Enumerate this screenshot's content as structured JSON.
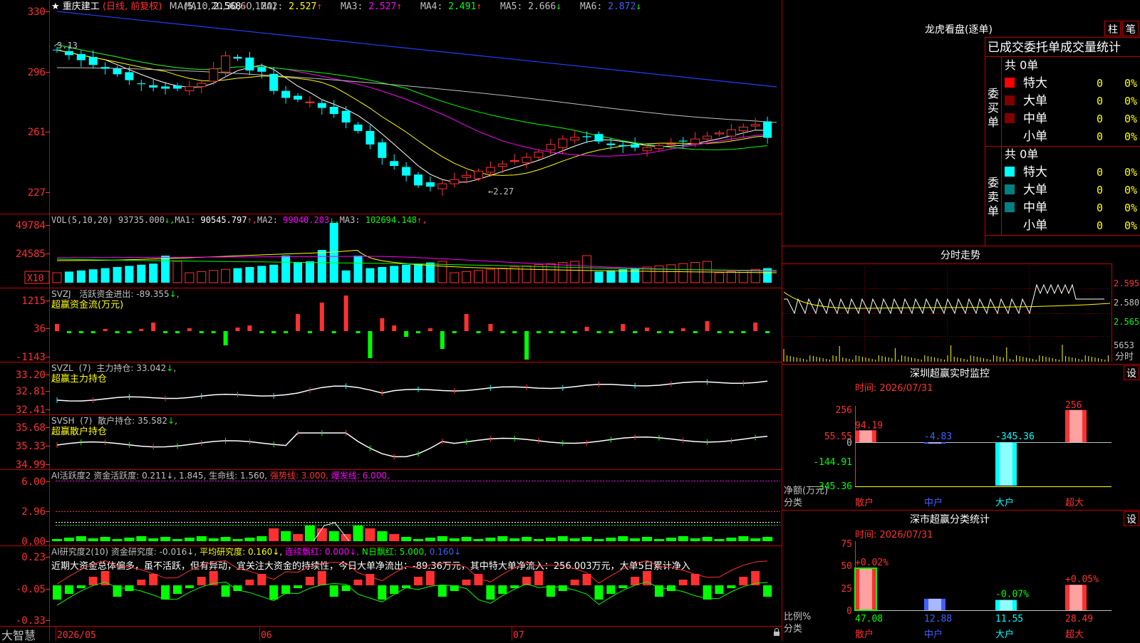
{
  "stock": {
    "name": "重庆建工",
    "star": "★",
    "period": "(日线, 前复权)"
  },
  "colors": {
    "bg": "#000000",
    "frame": "#c00000",
    "up": "#ff3030",
    "down": "#00ffff",
    "ma1": "#ffffff",
    "ma2": "#ffff00",
    "ma3": "#ff00ff",
    "ma4": "#00ff00",
    "ma5": "#c0c0c0",
    "ma6": "#0000ff",
    "green": "#00ff00",
    "yellow": "#ffff00",
    "magenta": "#ff00ff",
    "red": "#ff3030"
  },
  "price_panel": {
    "ma_label": "MA(5,10,20,30,60,120)",
    "ma": [
      {
        "name": "MA1:",
        "value": "2.568",
        "arrow": "↑",
        "arrow_color": "#ff3030",
        "color": "#ffffff"
      },
      {
        "name": "MA2:",
        "value": "2.527",
        "arrow": "↑",
        "arrow_color": "#ff3030",
        "color": "#ffff00"
      },
      {
        "name": "MA3:",
        "value": "2.527",
        "arrow": "↑",
        "arrow_color": "#ff3030",
        "color": "#ff00ff"
      },
      {
        "name": "MA4:",
        "value": "2.491",
        "arrow": "↑",
        "arrow_color": "#ff3030",
        "color": "#00ff00"
      },
      {
        "name": "MA5:",
        "value": "2.666",
        "arrow": "↓",
        "arrow_color": "#00ff00",
        "color": "#c0c0c0"
      },
      {
        "name": "MA6:",
        "value": "2.872",
        "arrow": "↓",
        "arrow_color": "#00ff00",
        "color": "#4060ff"
      }
    ],
    "y_ticks": [
      "330",
      "296",
      "261",
      "227"
    ],
    "y_tick_values": [
      3.3,
      2.96,
      2.61,
      2.27
    ],
    "high_label": "3.13",
    "low_label": "←2.27",
    "high_value": 3.13,
    "low_value": 2.27
  },
  "volume_panel": {
    "label": "VOL(5,10,20)",
    "value": "93735.000",
    "value_arrow": "↓",
    "ma": [
      {
        "name": "MA1:",
        "value": "90545.797",
        "arrow": "↑",
        "color": "#ffffff"
      },
      {
        "name": "MA2:",
        "value": "99040.203",
        "arrow": "↓",
        "color": "#ff00ff"
      },
      {
        "name": "MA3:",
        "value": "102694.148",
        "arrow": "↑",
        "color": "#00ff00"
      }
    ],
    "y_ticks": [
      "49784",
      "24585"
    ],
    "unit": "X10"
  },
  "svzj_panel": {
    "label": "SVZJ",
    "title": "活跃资金进出:",
    "value": "-89.355",
    "arrow": "↓",
    "subtitle": "超赢资金流(万元)",
    "y_ticks": [
      "1215",
      "36",
      "-1143"
    ]
  },
  "svzl_panel": {
    "label": "SVZL",
    "param": "(7)",
    "title": "主力持仓:",
    "value": "33.042",
    "arrow": "↓",
    "subtitle": "超赢主力持仓",
    "y_ticks": [
      "33.20",
      "32.81",
      "32.41"
    ]
  },
  "svsh_panel": {
    "label": "SVSH",
    "param": "(7)",
    "title": "散户持仓:",
    "value": "35.582",
    "arrow": "↓",
    "subtitle": "超赢散户持仓",
    "y_ticks": [
      "35.68",
      "35.33",
      "34.99"
    ]
  },
  "ai_active_panel": {
    "label": "AI活跃度2",
    "items": [
      {
        "text": "资金活跃度:",
        "color": "#c0c0c0"
      },
      {
        "text": "0.211↓,",
        "color": "#c0c0c0"
      },
      {
        "text": "1.845,",
        "color": "#c0c0c0"
      },
      {
        "text": "生命线:",
        "color": "#c0c0c0"
      },
      {
        "text": "1.560,",
        "color": "#c0c0c0"
      },
      {
        "text": "强势线:",
        "color": "#ff3030"
      },
      {
        "text": "3.000,",
        "color": "#ff3030"
      },
      {
        "text": "爆发线:",
        "color": "#ff00ff"
      },
      {
        "text": "6.000,",
        "color": "#ff00ff"
      }
    ],
    "y_ticks": [
      "6.00",
      "2.96",
      "0.00"
    ]
  },
  "ai_research_panel": {
    "label": "AI研究度2(10)",
    "items": [
      {
        "text": "资金研究度:",
        "color": "#c0c0c0"
      },
      {
        "text": "-0.016↓,",
        "color": "#c0c0c0"
      },
      {
        "text": "平均研究度:",
        "color": "#ffff00"
      },
      {
        "text": "0.160↓,",
        "color": "#ffff00"
      },
      {
        "text": "连续飘红:",
        "color": "#ff00ff"
      },
      {
        "text": "0.000↓,",
        "color": "#ff00ff"
      },
      {
        "text": "N日飘红:",
        "color": "#00ff00"
      },
      {
        "text": "5.000,",
        "color": "#00ff00"
      },
      {
        "text": "0.160↓",
        "color": "#4060ff"
      }
    ],
    "note": "近期大资金总体偏多，虽不活跃，但有异动，宜关注大资金的持续性，今日大单净流出：-89.36万元，其中特大单净流入：256.003万元，大单5日累计净入",
    "y_ticks": [
      "0.23",
      "-0.05",
      "-0.33"
    ]
  },
  "x_axis": {
    "labels": [
      "2026/05",
      "06",
      "07"
    ]
  },
  "footer": {
    "brand": "大智慧"
  },
  "dragon_tiger": {
    "title": "龙虎看盘(逐单)",
    "tabs": [
      "柱",
      "笔"
    ],
    "header": "已成交委托单成交量统计",
    "buy": {
      "side_label": "委买单",
      "total": "共 0单",
      "rows": [
        {
          "name": "特大",
          "count": "0",
          "pct": "0%",
          "color": "#ff0000"
        },
        {
          "name": "大单",
          "count": "0",
          "pct": "0%",
          "color": "#800000"
        },
        {
          "name": "中单",
          "count": "0",
          "pct": "0%",
          "color": "#800000"
        },
        {
          "name": "小单",
          "count": "0",
          "pct": "0%",
          "color": ""
        }
      ]
    },
    "sell": {
      "side_label": "委卖单",
      "total": "共 0单",
      "rows": [
        {
          "name": "特大",
          "count": "0",
          "pct": "0%",
          "color": "#00ffff"
        },
        {
          "name": "大单",
          "count": "0",
          "pct": "0%",
          "color": "#008080"
        },
        {
          "name": "中单",
          "count": "0",
          "pct": "0%",
          "color": "#008080"
        },
        {
          "name": "小单",
          "count": "0",
          "pct": "0%",
          "color": ""
        }
      ]
    }
  },
  "intraday": {
    "title": "分时走势",
    "right_ticks": [
      "2.595",
      "2.580",
      "2.565"
    ],
    "vol_ticks": [
      "5653",
      "分时"
    ]
  },
  "sz_monitor": {
    "title": "深圳超赢实时监控",
    "settings": "设",
    "time": "时间: 2026/07/31",
    "left_ticks": [
      "256",
      "55.55",
      "0",
      "-144.91",
      "-345.36"
    ],
    "axis_label_1": "净额(万元)",
    "axis_label_2": "分类",
    "categories": [
      "散户",
      "中户",
      "大户",
      "超大"
    ],
    "category_colors": [
      "#ff3030",
      "#4060ff",
      "#00ffff",
      "#ff3030"
    ],
    "value_labels": [
      "94.19",
      "-4.83",
      "-345.36",
      "256"
    ],
    "values": [
      94.19,
      -4.83,
      -345.36,
      256.0
    ],
    "ylim": [
      -345.36,
      256
    ]
  },
  "sz_stats": {
    "title": "深市超赢分类统计",
    "settings": "设",
    "time": "时间: 2026/07/31",
    "left_ticks": [
      "75",
      "50",
      "25",
      "0"
    ],
    "axis_label_1": "比例%",
    "axis_label_2": "分类",
    "categories": [
      "散户",
      "中户",
      "大户",
      "超大"
    ],
    "category_colors": [
      "#ff3030",
      "#4060ff",
      "#00ffff",
      "#ff3030"
    ],
    "values": [
      47.08,
      12.88,
      11.55,
      28.49
    ],
    "value_labels": [
      "47.08",
      "12.88",
      "11.55",
      "28.49"
    ],
    "change_labels": [
      "+0.02%",
      "",
      "-0.07%",
      "+0.05%"
    ],
    "change_colors": [
      "#ff3030",
      "",
      "#00ff00",
      "#ff3030"
    ],
    "ylim": [
      0,
      75
    ]
  }
}
